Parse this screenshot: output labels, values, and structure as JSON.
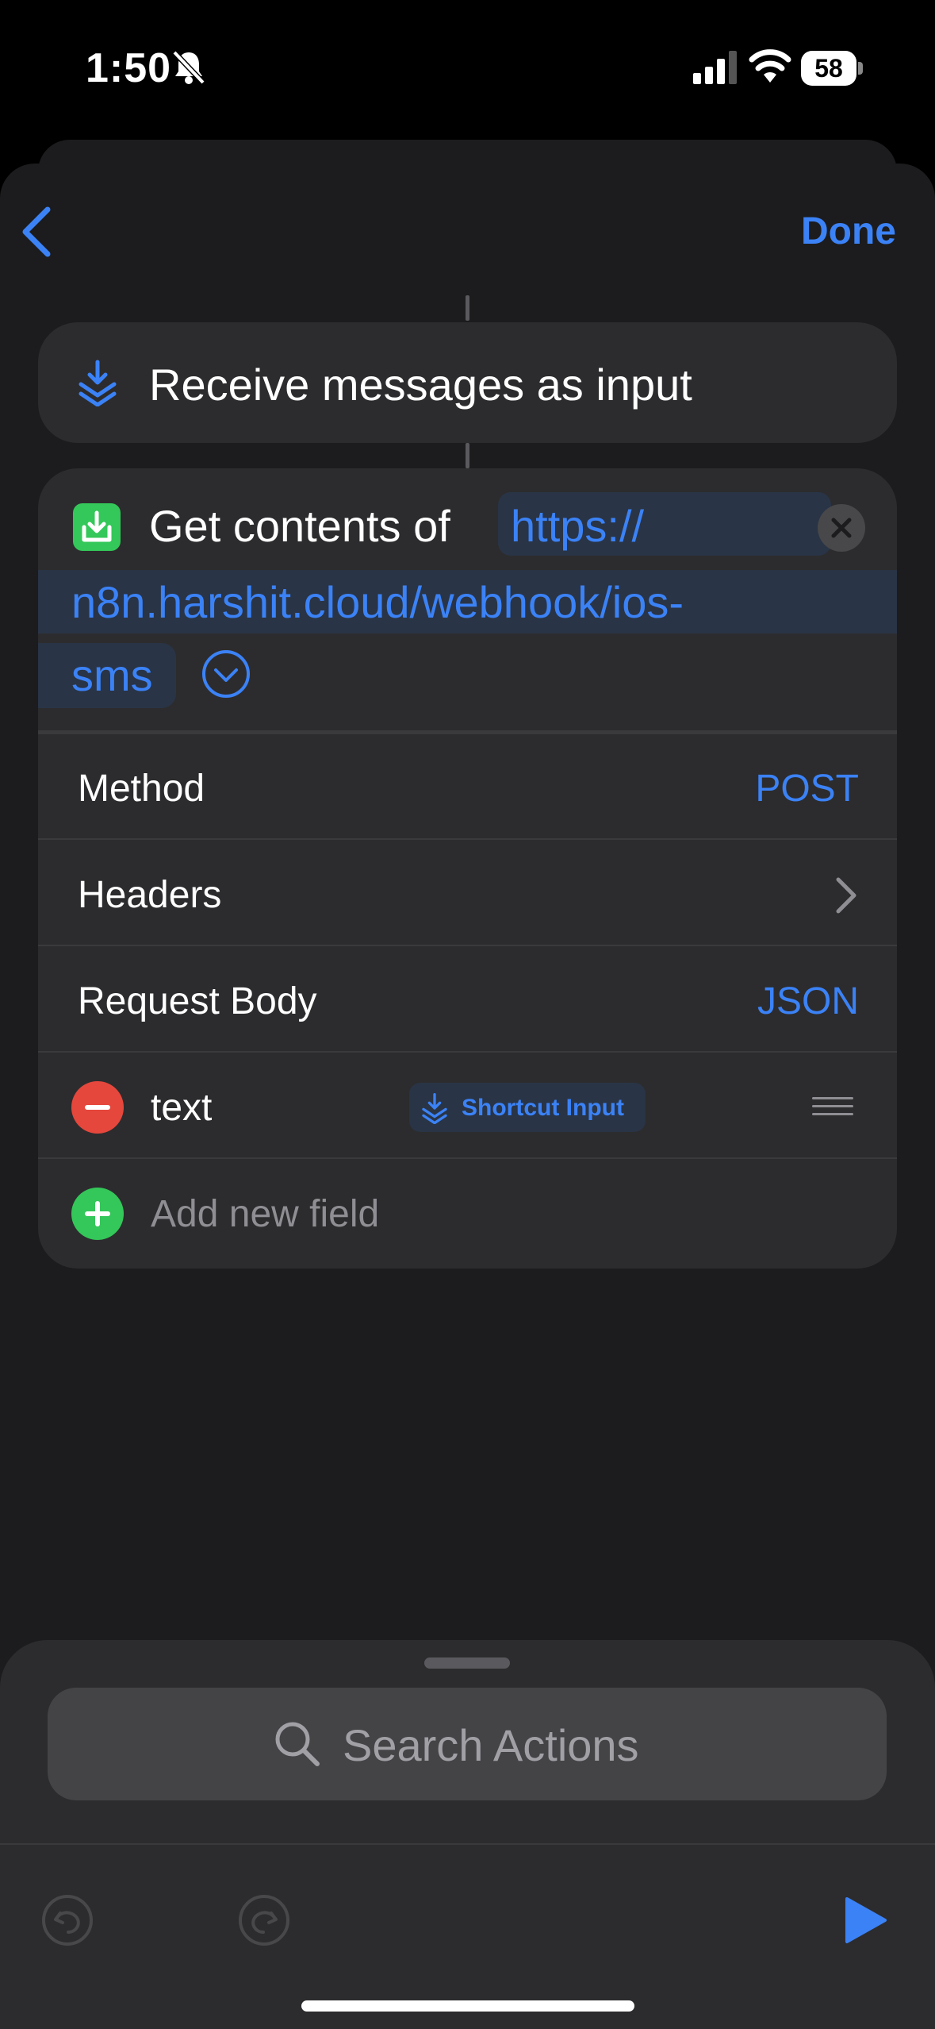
{
  "status_bar": {
    "time": "1:50",
    "battery": "58",
    "icons": [
      "bell-slash-icon",
      "cellular-signal-icon",
      "wifi-icon",
      "battery-icon"
    ]
  },
  "nav": {
    "back_icon": "chevron-left-icon",
    "done_label": "Done"
  },
  "actions": {
    "receive": {
      "title": "Receive messages as input",
      "icon": "shortcut-input-icon"
    },
    "get_contents": {
      "label": "Get contents of",
      "url_line1": "https://",
      "url_line2": "n8n.harshit.cloud/webhook/ios-",
      "url_line3": "sms",
      "icon": "download-tray-icon",
      "rows": {
        "method_label": "Method",
        "method_value": "POST",
        "headers_label": "Headers",
        "body_label": "Request Body",
        "body_value": "JSON"
      },
      "fields": [
        {
          "key": "text",
          "value": "Shortcut Input"
        }
      ],
      "add_field_label": "Add new field"
    }
  },
  "bottom_panel": {
    "search_placeholder": "Search Actions"
  },
  "colors": {
    "accent": "#3b82f6",
    "green": "#34c759",
    "red": "#e5473c",
    "background": "#1c1c1e",
    "card": "#2c2c2e"
  }
}
